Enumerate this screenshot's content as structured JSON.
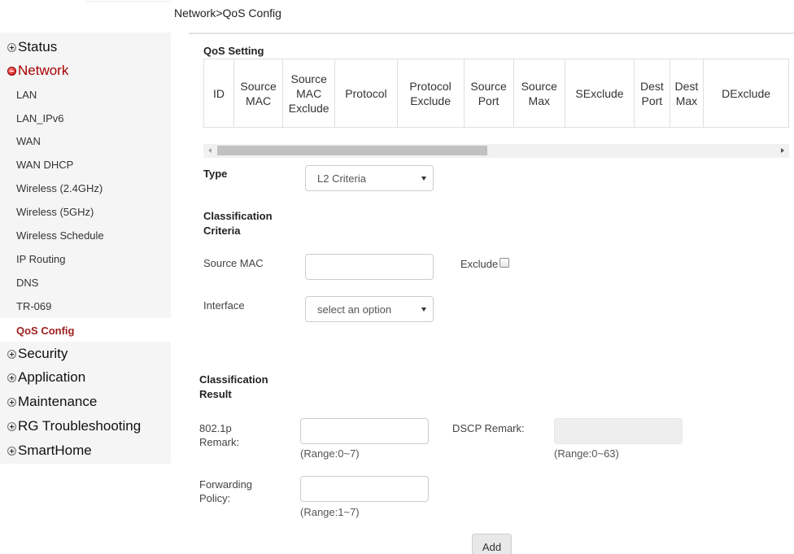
{
  "breadcrumb": "Network>QoS Config",
  "sidebar": {
    "groups": {
      "status": "Status",
      "network": "Network",
      "security": "Security",
      "application": "Application",
      "maintenance": "Maintenance",
      "rg_troubleshooting": "RG Troubleshooting",
      "smarthome": "SmartHome"
    },
    "network_items": [
      "LAN",
      "LAN_IPv6",
      "WAN",
      "WAN DHCP",
      "Wireless (2.4GHz)",
      "Wireless (5GHz)",
      "Wireless Schedule",
      "IP Routing",
      "DNS",
      "TR-069",
      "QoS Config"
    ],
    "active_item": "QoS Config"
  },
  "qos_setting": {
    "title": "QoS Setting",
    "columns": [
      "ID",
      "Source MAC",
      "Source MAC Exclude",
      "Protocol",
      "Protocol Exclude",
      "Source Port",
      "Source Max",
      "SExclude",
      "Dest Port",
      "Dest Max",
      "DExclude"
    ],
    "rows": []
  },
  "form": {
    "type_label": "Type",
    "type_value": "L2 Criteria",
    "criteria_title": "Classification Criteria",
    "source_mac_label": "Source MAC",
    "source_mac_value": "",
    "exclude_label": "Exclude",
    "exclude_checked": false,
    "interface_label": "Interface",
    "interface_value": "select an option",
    "result_title": "Classification Result",
    "remark_8021p_label": "802.1p Remark:",
    "remark_8021p_value": "",
    "remark_8021p_range": "(Range:0~7)",
    "dscp_label": "DSCP Remark:",
    "dscp_value": "",
    "dscp_range": "(Range:0~63)",
    "forwarding_label": "Forwarding Policy:",
    "forwarding_value": "",
    "forwarding_range": "(Range:1~7)",
    "add_button": "Add"
  },
  "colors": {
    "network_group": "#a80000",
    "active_item": "#a01f1f",
    "sidebar_bg": "#f5f5f5"
  }
}
